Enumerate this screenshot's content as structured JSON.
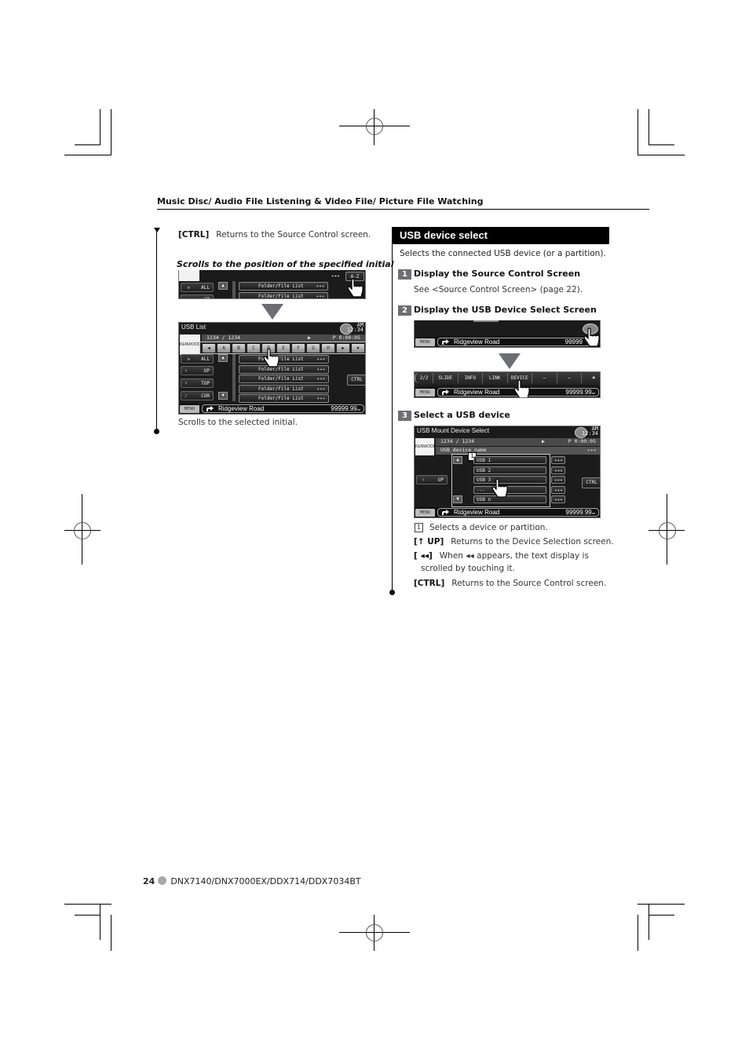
{
  "header": {
    "title": "Music Disc/ Audio File Listening & Video File/ Picture File Watching"
  },
  "left_column": {
    "ctrl_key": "[CTRL]",
    "ctrl_desc": "Returns to the Source Control screen.",
    "subheading": "Scrolls to the position of the specified initial",
    "screen_a": {
      "az_button": "A-Z",
      "all_button": "ALL",
      "up_button": "UP",
      "list_items": [
        "Folder/File List",
        "Folder/File List"
      ],
      "scroll_indicator": "◂◂◂"
    },
    "screen_b": {
      "title": "USB List",
      "clock_ampm": "AM",
      "clock_time": "12:34",
      "track_count": "1234 / 1234",
      "play_icon": "▶",
      "play_time": "P 0:00:05",
      "logo": "KENWOOD",
      "alpha_keys": [
        "◀",
        "A",
        "B",
        "C",
        "D",
        "E",
        "F",
        "G",
        "H",
        "▶",
        "✖"
      ],
      "side_buttons": [
        "ALL",
        "UP",
        "TOP",
        "CUR"
      ],
      "list_items": [
        "Folder/File List",
        "Folder/File List",
        "Folder/File List",
        "Folder/File List",
        "Folder/File List"
      ],
      "ctrl_button": "CTRL",
      "menu_button": "MENU",
      "road_name": "Ridgeview Road",
      "distance": "99999.99",
      "distance_unit": "mi"
    },
    "caption": "Scrolls to the selected initial."
  },
  "right_column": {
    "section_title": "USB device select",
    "intro": "Selects the connected USB device (or a partition).",
    "steps": [
      {
        "number": "1",
        "title": "Display the Source Control Screen",
        "desc": "See <Source Control Screen> (page 22)."
      },
      {
        "number": "2",
        "title": "Display the USB Device Select Screen"
      },
      {
        "number": "3",
        "title": "Select a USB device"
      }
    ],
    "screen_c": {
      "menu_button": "MENU",
      "road_name": "Ridgeview Road",
      "distance": "99999"
    },
    "screen_d": {
      "page": "2/2",
      "tabs": [
        "SLIDE",
        "INFO",
        "LINK",
        "DEVICE",
        "—",
        "—",
        "✖"
      ],
      "menu_button": "MENU",
      "road_name": "Ridgeview Road",
      "distance": "99999.99",
      "distance_unit": "mi"
    },
    "screen_e": {
      "title": "USB Mount Device Select",
      "clock_ampm": "AM",
      "clock_time": "12:34",
      "track_count": "1234 / 1234",
      "play_icon": "▶",
      "play_time": "P 0:00:05",
      "device_name": "USB device name",
      "logo": "KENWOOD",
      "devices": [
        "USB 1",
        "USB 2",
        "USB 3",
        "---",
        "USB n"
      ],
      "up_button": "UP",
      "ctrl_button": "CTRL",
      "menu_button": "MENU",
      "road_name": "Ridgeview Road",
      "distance": "99999.99",
      "distance_unit": "mi",
      "callout": "1"
    },
    "notes": [
      {
        "key": "1",
        "desc": "Selects a device or partition."
      },
      {
        "key": "[↑ UP]",
        "desc": "Returns to the Device Selection screen."
      },
      {
        "key": "[ ◂◂]",
        "desc": "When ◂◂ appears, the text display is",
        "desc2": "scrolled by touching it."
      },
      {
        "key": "[CTRL]",
        "desc": "Returns to the Source Control screen."
      }
    ]
  },
  "footer": {
    "page_number": "24",
    "models": "DNX7140/DNX7000EX/DDX714/DDX7034BT"
  }
}
